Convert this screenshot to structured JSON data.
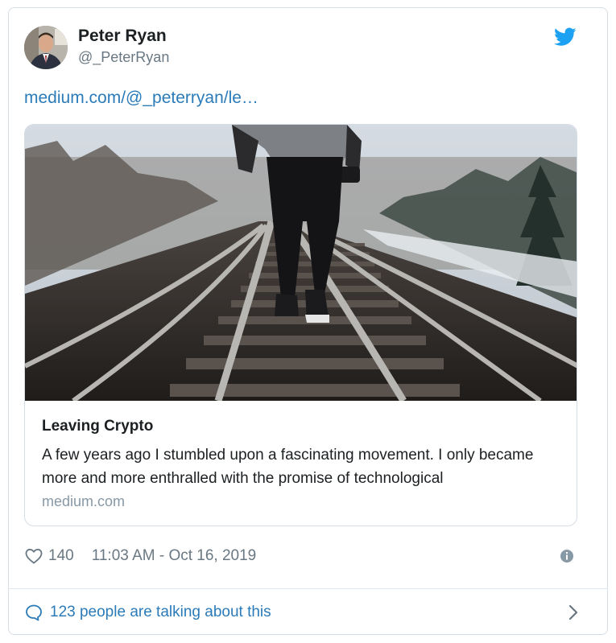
{
  "author": {
    "name": "Peter Ryan",
    "handle": "@_PeterRyan"
  },
  "icons": {
    "brand": "twitter-bird-icon",
    "like": "heart-icon",
    "info": "info-icon",
    "reply": "speech-bubble-icon",
    "more": "chevron-right-icon"
  },
  "tweet": {
    "link_text": "medium.com/@_peterryan/le…"
  },
  "card": {
    "title": "Leaving Crypto",
    "description": "A few years ago I stumbled upon a fascinating movement. I only became more and more enthralled with the promise of technological",
    "domain": "medium.com"
  },
  "meta": {
    "likes": "140",
    "timestamp": "11:03 AM - Oct 16, 2019"
  },
  "footer": {
    "talk_text": "123 people are talking about this"
  },
  "colors": {
    "brand": "#1da1f2",
    "link": "#2b7bb9",
    "muted": "#697882",
    "border": "#d6dde3"
  }
}
